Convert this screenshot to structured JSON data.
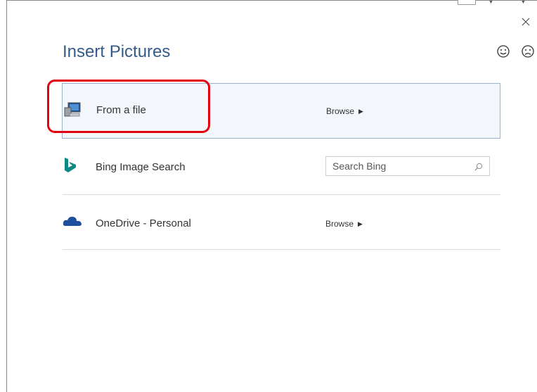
{
  "dialog": {
    "title": "Insert Pictures",
    "close_icon": "close-icon",
    "feedback": {
      "smile_icon": "smile-icon",
      "frown_icon": "frown-icon"
    }
  },
  "sources": {
    "from_file": {
      "label": "From a file",
      "action": "Browse",
      "icon": "computer-icon"
    },
    "bing": {
      "label": "Bing Image Search",
      "search_placeholder": "Search Bing",
      "icon": "bing-icon"
    },
    "onedrive": {
      "label": "OneDrive - Personal",
      "action": "Browse",
      "icon": "onedrive-cloud-icon"
    }
  },
  "colors": {
    "title": "#345c8a",
    "selected_row_border": "#9ab3d4",
    "selected_row_bg": "#f3f6fb",
    "annotation_red": "#e2000f",
    "bing_teal": "#0b8a83",
    "onedrive_blue": "#1e4e9c"
  }
}
